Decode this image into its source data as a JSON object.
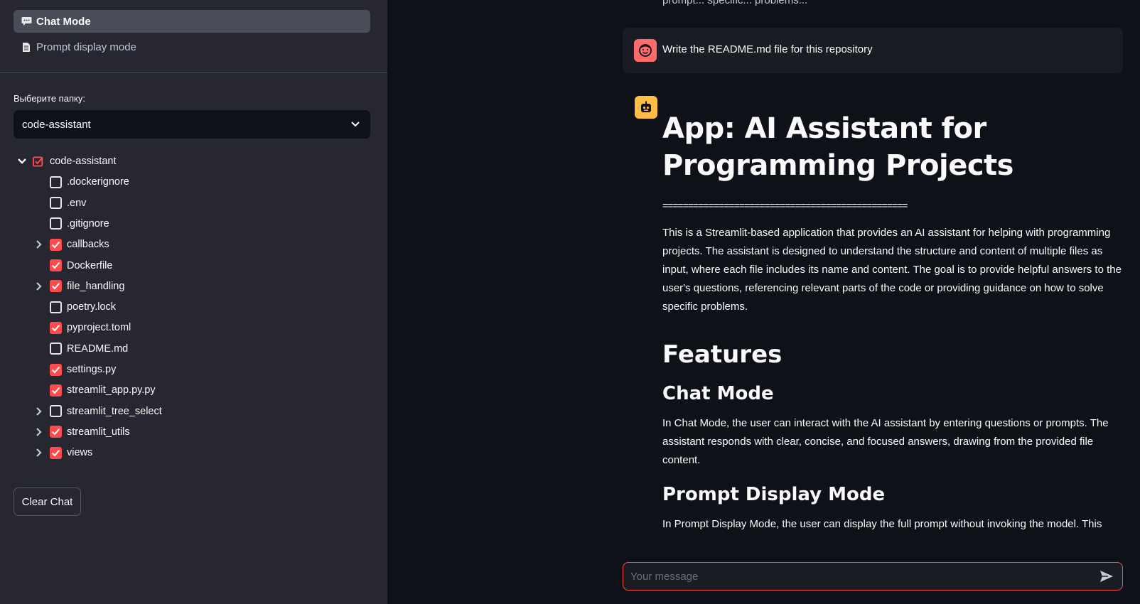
{
  "sidebar": {
    "nav": [
      {
        "label": "Chat Mode",
        "icon": "speech-bubble-icon",
        "active": true
      },
      {
        "label": "Prompt display mode",
        "icon": "document-icon",
        "active": false
      }
    ],
    "folder_label": "Выберите папку:",
    "folder_select": {
      "value": "code-assistant",
      "icon": "chevron-down-icon"
    },
    "tree": {
      "root": {
        "label": "code-assistant",
        "state": "partial",
        "expanded": true
      },
      "items": [
        {
          "label": ".dockerignore",
          "checked": false,
          "expandable": false
        },
        {
          "label": ".env",
          "checked": false,
          "expandable": false
        },
        {
          "label": ".gitignore",
          "checked": false,
          "expandable": false
        },
        {
          "label": "callbacks",
          "checked": true,
          "expandable": true
        },
        {
          "label": "Dockerfile",
          "checked": true,
          "expandable": false
        },
        {
          "label": "file_handling",
          "checked": true,
          "expandable": true
        },
        {
          "label": "poetry.lock",
          "checked": false,
          "expandable": false
        },
        {
          "label": "pyproject.toml",
          "checked": true,
          "expandable": false
        },
        {
          "label": "README.md",
          "checked": false,
          "expandable": false
        },
        {
          "label": "settings.py",
          "checked": true,
          "expandable": false
        },
        {
          "label": "streamlit_app.py.py",
          "checked": true,
          "expandable": false
        },
        {
          "label": "streamlit_tree_select",
          "checked": false,
          "expandable": true
        },
        {
          "label": "streamlit_utils",
          "checked": true,
          "expandable": true
        },
        {
          "label": "views",
          "checked": true,
          "expandable": true
        }
      ]
    },
    "clear_chat_label": "Clear Chat"
  },
  "chat": {
    "top_fragment": "prompt... specific... problems...",
    "user_message": "Write the README.md file for this repository",
    "assistant": {
      "title": "App: AI Assistant for Programming Projects",
      "rule": "================================================",
      "intro": "This is a Streamlit-based application that provides an AI assistant for helping with programming projects. The assistant is designed to understand the structure and content of multiple files as input, where each file includes its name and content. The goal is to provide helpful answers to the user's questions, referencing relevant parts of the code or providing guidance on how to solve specific problems.",
      "features_heading": "Features",
      "chat_mode_heading": "Chat Mode",
      "chat_mode_text": "In Chat Mode, the user can interact with the AI assistant by entering questions or prompts. The assistant responds with clear, concise, and focused answers, drawing from the provided file content.",
      "prompt_mode_heading": "Prompt Display Mode",
      "prompt_mode_text": "In Prompt Display Mode, the user can display the full prompt without invoking the model. This"
    },
    "input": {
      "placeholder": "Your message",
      "value": ""
    }
  },
  "colors": {
    "accent": "#ff4b4b",
    "sidebar_bg": "#262730",
    "main_bg": "#0e1117",
    "user_avatar": "#ff6b6b",
    "bot_avatar": "#ffbd45"
  }
}
